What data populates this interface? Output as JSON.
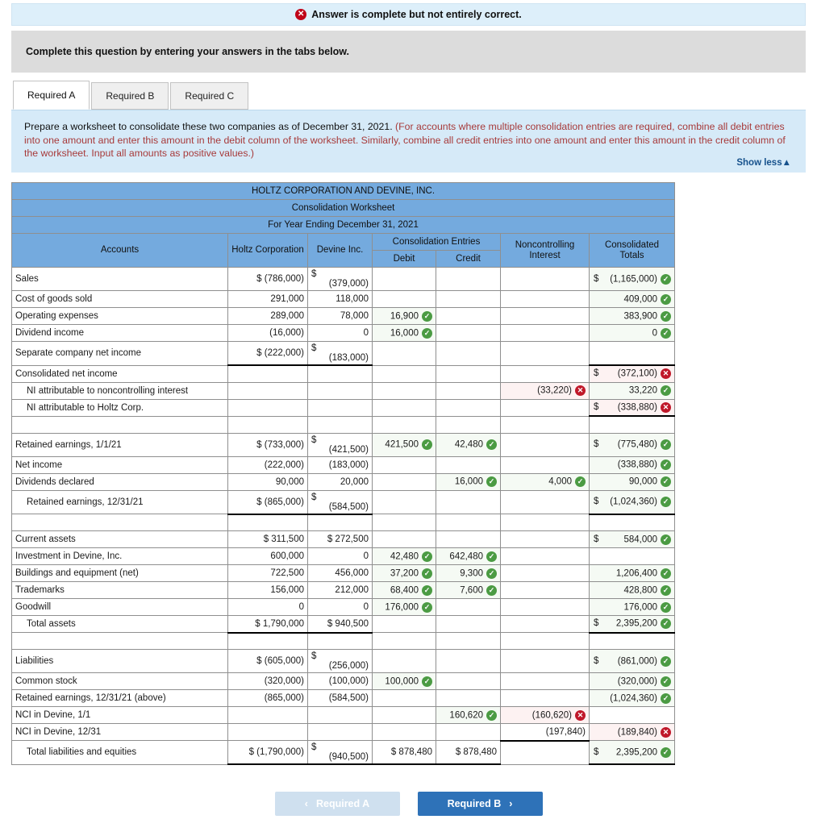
{
  "alert": {
    "icon": "error-circle-icon",
    "text": "Answer is complete but not entirely correct."
  },
  "instruction_strip": {
    "text": "Complete this question by entering your answers in the tabs below."
  },
  "tabs": [
    {
      "label": "Required A",
      "active": true
    },
    {
      "label": "Required B",
      "active": false
    },
    {
      "label": "Required C",
      "active": false
    }
  ],
  "question": {
    "lead": "Prepare a worksheet to consolidate these two companies as of December 31, 2021. ",
    "hint": "(For accounts where multiple consolidation entries are required, combine all debit entries into one amount and enter this amount in the debit column of the worksheet. Similarly, combine all credit entries into one amount and enter this amount in the credit column of the worksheet. Input all amounts as positive values.)",
    "show_less": "Show less"
  },
  "worksheet": {
    "title1": "HOLTZ CORPORATION AND DEVINE, INC.",
    "title2": "Consolidation Worksheet",
    "title3": "For Year Ending December 31, 2021",
    "headers": {
      "accounts": "Accounts",
      "holtz": "Holtz Corporation",
      "devine": "Devine Inc.",
      "consolidation_entries": "Consolidation Entries",
      "debit": "Debit",
      "credit": "Credit",
      "ncin": "Noncontrolling Interest",
      "totals": "Consolidated Totals"
    },
    "rows": [
      {
        "label": "Sales",
        "holtz": "$   (786,000)",
        "devine_d": "$",
        "devine": "(379,000)",
        "debit": "",
        "credit": "",
        "nci": "",
        "total_d": "$",
        "total": "(1,165,000)",
        "total_mark": "ok"
      },
      {
        "label": "Cost of goods sold",
        "holtz": "291,000",
        "devine": "118,000",
        "debit": "",
        "credit": "",
        "nci": "",
        "total": "409,000",
        "total_mark": "ok"
      },
      {
        "label": "Operating expenses",
        "holtz": "289,000",
        "devine": "78,000",
        "debit": "16,900",
        "debit_mark": "ok",
        "credit": "",
        "nci": "",
        "total": "383,900",
        "total_mark": "ok"
      },
      {
        "label": "Dividend income",
        "holtz": "(16,000)",
        "devine": "0",
        "debit": "16,000",
        "debit_mark": "ok",
        "credit": "",
        "nci": "",
        "total": "0",
        "total_mark": "ok"
      },
      {
        "label": "Separate company net income",
        "underline": true,
        "holtz": "$   (222,000)",
        "devine_d": "$",
        "devine": "(183,000)",
        "debit": "",
        "credit": "",
        "nci": "",
        "total": ""
      },
      {
        "label": "Consolidated net income",
        "holtz": "",
        "devine": "",
        "debit": "",
        "credit": "",
        "nci": "",
        "total_d": "$",
        "total": "(372,100)",
        "total_mark": "no"
      },
      {
        "label": "NI attributable to noncontrolling interest",
        "indent": true,
        "holtz": "",
        "devine": "",
        "debit": "",
        "credit": "",
        "nci": "(33,220)",
        "nci_mark": "no",
        "total": "33,220",
        "total_mark": "ok"
      },
      {
        "label": "NI attributable to Holtz Corp.",
        "indent": true,
        "total_underline": true,
        "holtz": "",
        "devine": "",
        "debit": "",
        "credit": "",
        "nci": "",
        "total_d": "$",
        "total": "(338,880)",
        "total_mark": "no"
      },
      {
        "spacer": true
      },
      {
        "label": "Retained earnings, 1/1/21",
        "holtz": "$   (733,000)",
        "devine_d": "$",
        "devine": "(421,500)",
        "debit": "421,500",
        "debit_mark": "ok",
        "credit": "42,480",
        "credit_mark": "ok",
        "nci": "",
        "total_d": "$",
        "total": "(775,480)",
        "total_mark": "ok"
      },
      {
        "label": "Net income",
        "holtz": "(222,000)",
        "devine": "(183,000)",
        "debit": "",
        "credit": "",
        "nci": "",
        "total": "(338,880)",
        "total_mark": "ok"
      },
      {
        "label": "Dividends declared",
        "holtz": "90,000",
        "devine": "20,000",
        "debit": "",
        "credit": "16,000",
        "credit_mark": "ok",
        "nci": "4,000",
        "nci_mark": "ok",
        "total": "90,000",
        "total_mark": "ok"
      },
      {
        "label": "Retained earnings, 12/31/21",
        "indent": true,
        "underline": true,
        "total_underline": true,
        "holtz": "$   (865,000)",
        "devine_d": "$",
        "devine": "(584,500)",
        "debit": "",
        "credit": "",
        "nci": "",
        "total_d": "$",
        "total": "(1,024,360)",
        "total_mark": "ok"
      },
      {
        "spacer": true
      },
      {
        "label": "Current assets",
        "holtz": "$      311,500",
        "devine": "$ 272,500",
        "debit": "",
        "credit": "",
        "nci": "",
        "total_d": "$",
        "total": "584,000",
        "total_mark": "ok"
      },
      {
        "label": "Investment in Devine, Inc.",
        "holtz": "600,000",
        "devine": "0",
        "debit": "42,480",
        "debit_mark": "ok",
        "credit": "642,480",
        "credit_mark": "ok",
        "nci": "",
        "total": ""
      },
      {
        "label": "Buildings and equipment (net)",
        "holtz": "722,500",
        "devine": "456,000",
        "debit": "37,200",
        "debit_mark": "ok",
        "credit": "9,300",
        "credit_mark": "ok",
        "nci": "",
        "total": "1,206,400",
        "total_mark": "ok"
      },
      {
        "label": "Trademarks",
        "holtz": "156,000",
        "devine": "212,000",
        "debit": "68,400",
        "debit_mark": "ok",
        "credit": "7,600",
        "credit_mark": "ok",
        "nci": "",
        "total": "428,800",
        "total_mark": "ok"
      },
      {
        "label": "Goodwill",
        "holtz": "0",
        "devine": "0",
        "debit": "176,000",
        "debit_mark": "ok",
        "credit": "",
        "nci": "",
        "total": "176,000",
        "total_mark": "ok"
      },
      {
        "label": "Total assets",
        "indent": true,
        "underline": true,
        "total_underline": true,
        "holtz": "$   1,790,000",
        "devine": "$ 940,500",
        "debit": "",
        "credit": "",
        "nci": "",
        "total_d": "$",
        "total": "2,395,200",
        "total_mark": "ok"
      },
      {
        "spacer": true
      },
      {
        "label": "Liabilities",
        "holtz": "$   (605,000)",
        "devine_d": "$",
        "devine": "(256,000)",
        "debit": "",
        "credit": "",
        "nci": "",
        "total_d": "$",
        "total": "(861,000)",
        "total_mark": "ok"
      },
      {
        "label": "Common stock",
        "holtz": "(320,000)",
        "devine": "(100,000)",
        "debit": "100,000",
        "debit_mark": "ok",
        "credit": "",
        "nci": "",
        "total": "(320,000)",
        "total_mark": "ok"
      },
      {
        "label": "Retained earnings, 12/31/21 (above)",
        "holtz": "(865,000)",
        "devine": "(584,500)",
        "debit": "",
        "credit": "",
        "nci": "",
        "total": "(1,024,360)",
        "total_mark": "ok"
      },
      {
        "label": "NCI in Devine, 1/1",
        "holtz": "",
        "devine": "",
        "debit": "",
        "credit": "160,620",
        "credit_mark": "ok",
        "nci": "(160,620)",
        "nci_mark": "no",
        "total": ""
      },
      {
        "label": "NCI in Devine, 12/31",
        "nci_underline": true,
        "holtz": "",
        "devine": "",
        "debit": "",
        "credit": "",
        "nci": "(197,840)",
        "total": "(189,840)",
        "total_mark": "no"
      },
      {
        "label": "Total liabilities and equities",
        "indent": true,
        "underline": true,
        "total_underline": true,
        "entries_underline": true,
        "holtz": "$ (1,790,000)",
        "devine_d": "$",
        "devine": "(940,500)",
        "debit": "$ 878,480",
        "credit": "$ 878,480",
        "nci": "",
        "total_d": "$",
        "total": "2,395,200",
        "total_mark": "ok"
      }
    ]
  },
  "nav": {
    "prev_label": "Required A",
    "prev_icon": "chevron-left-icon",
    "next_label": "Required B",
    "next_icon": "chevron-right-icon"
  },
  "colors": {
    "header_blue": "#74aade",
    "panel_blue": "#d6eaf8",
    "alert_blue": "#ddeffa",
    "ok_green": "#4b9b43",
    "error_red": "#c0182a",
    "button_blue": "#2e72b8"
  }
}
